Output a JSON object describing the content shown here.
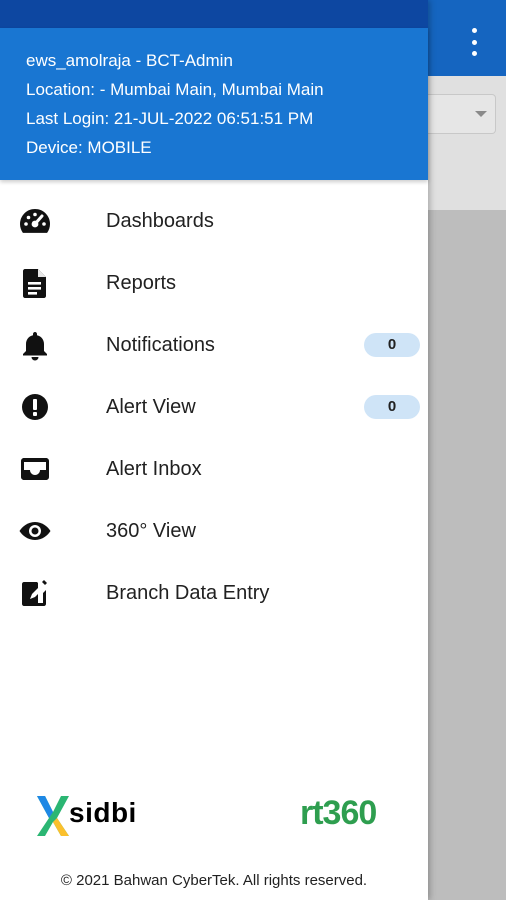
{
  "header": {
    "user_line": "ews_amolraja - BCT-Admin",
    "location_line": "Location: - Mumbai Main, Mumbai Main",
    "last_login_line": "Last Login: 21-JUL-2022 06:51:51 PM",
    "device_line": "Device: MOBILE"
  },
  "menu": {
    "items": [
      {
        "label": "Dashboards",
        "icon": "speedometer-icon"
      },
      {
        "label": "Reports",
        "icon": "document-icon"
      },
      {
        "label": "Notifications",
        "icon": "bell-icon",
        "badge": "0"
      },
      {
        "label": "Alert View",
        "icon": "exclamation-circle-icon",
        "badge": "0"
      },
      {
        "label": "Alert Inbox",
        "icon": "inbox-icon"
      },
      {
        "label": "360° View",
        "icon": "eye-icon"
      },
      {
        "label": "Branch Data Entry",
        "icon": "edit-box-icon"
      }
    ]
  },
  "footer": {
    "logo_left_text": "sidbi",
    "logo_right_text": "rt360",
    "copyright": "© 2021 Bahwan CyberTek. All rights reserved."
  },
  "colors": {
    "header_bg": "#1976d2",
    "status_bar": "#0d47a1",
    "badge_bg": "#cfe4f7",
    "brand_green": "#2e9e4f",
    "brand_blue": "#1565c0"
  }
}
